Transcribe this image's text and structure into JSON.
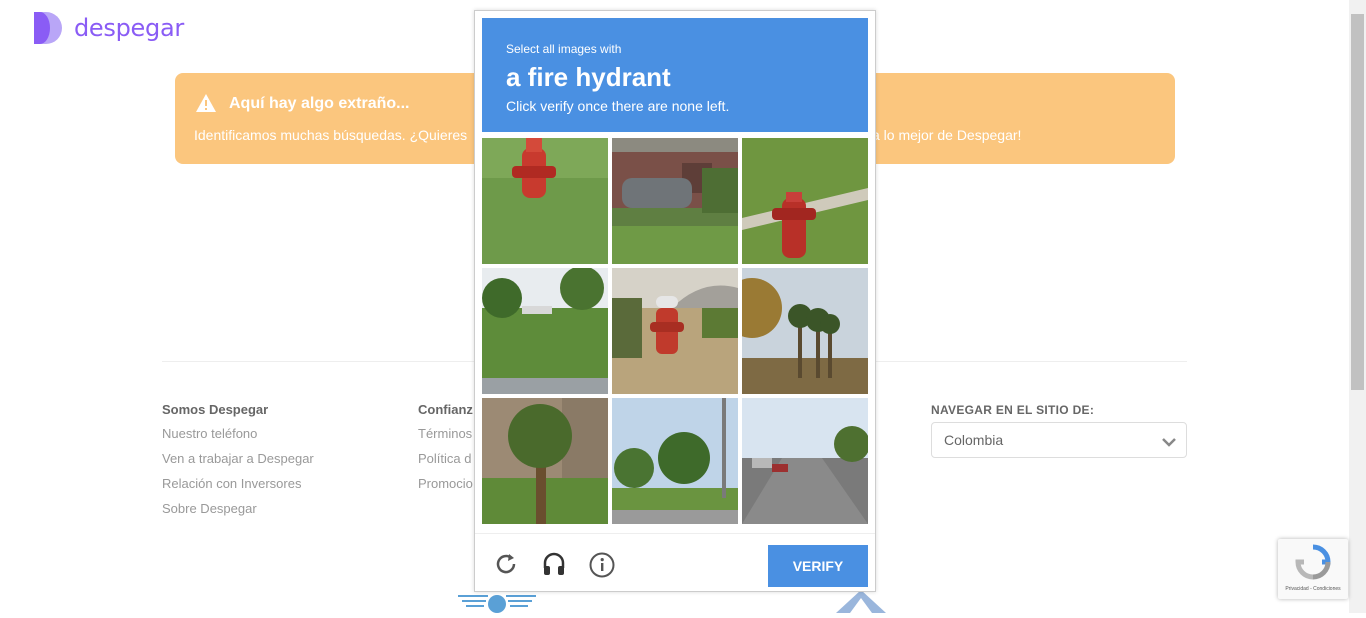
{
  "brand": {
    "name": "despegar",
    "color": "#8a5cf5"
  },
  "alert": {
    "title": "Aquí hay algo extraño...",
    "message_left": "Identificamos muchas búsquedas. ¿Quieres",
    "message_right": "a lo mejor de Despegar!",
    "color": "#fbc67e"
  },
  "footer": {
    "col1": {
      "heading": "Somos Despegar",
      "items": [
        "Nuestro teléfono",
        "Ven a trabajar a Despegar",
        "Relación con Inversores",
        "Sobre Despegar"
      ]
    },
    "col2": {
      "heading": "Confianz",
      "items": [
        "Términos",
        "Política d",
        "Promocio"
      ]
    },
    "nav_label": "NAVEGAR EN EL SITIO DE:",
    "country": "Colombia"
  },
  "captcha": {
    "prompt_small": "Select all images with",
    "prompt_object": "a fire hydrant",
    "prompt_instruction": "Click verify once there are none left.",
    "verify_label": "VERIFY",
    "accent": "#4a90e2",
    "tiles": [
      {
        "desc": "hydrant-on-grass"
      },
      {
        "desc": "car-driveway"
      },
      {
        "desc": "hydrant-by-path"
      },
      {
        "desc": "field-with-trees"
      },
      {
        "desc": "hydrant-by-road"
      },
      {
        "desc": "palm-trees"
      },
      {
        "desc": "small-palm"
      },
      {
        "desc": "park-trees"
      },
      {
        "desc": "street-with-cars"
      }
    ]
  },
  "recaptcha": {
    "terms": "Privacidad - Condiciones"
  }
}
